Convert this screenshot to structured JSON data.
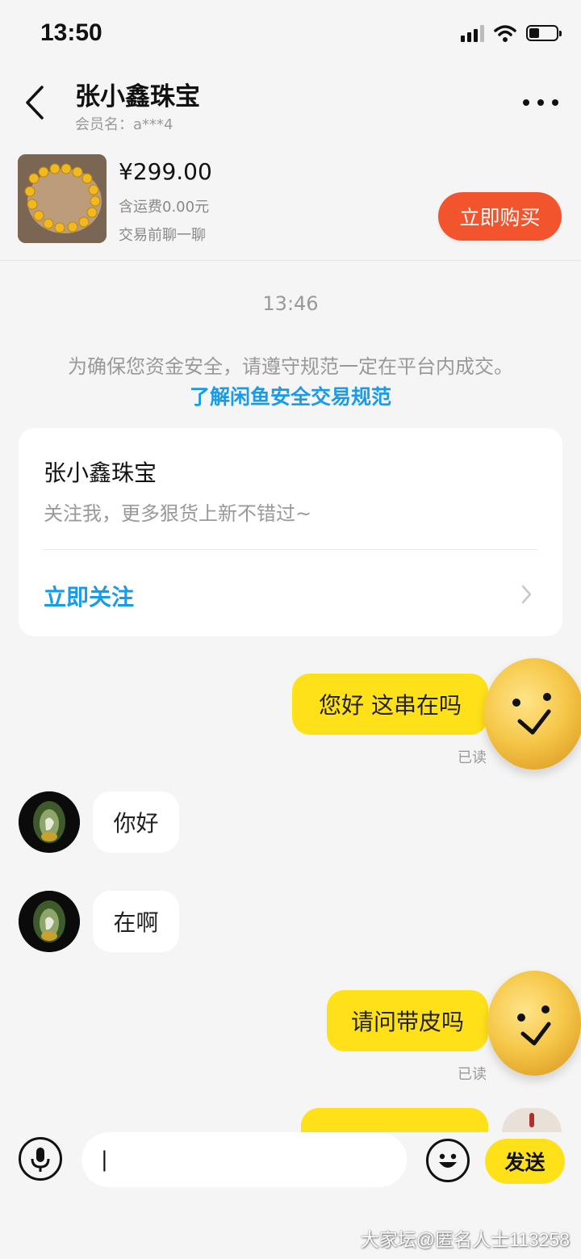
{
  "status_bar": {
    "time": "13:50"
  },
  "header": {
    "shop_name": "张小鑫珠宝",
    "member_name": "会员名：a***4"
  },
  "product": {
    "price": "¥299.00",
    "shipping": "含运费0.00元",
    "chat_before": "交易前聊一聊",
    "buy_label": "立即购买"
  },
  "chat": {
    "time": "13:46",
    "safety_note": "为确保您资金安全，请遵守规范一定在平台内成交。",
    "safety_link": "了解闲鱼安全交易规范",
    "follow_card": {
      "title": "张小鑫珠宝",
      "subtitle": "关注我，更多狠货上新不错过~",
      "action": "立即关注"
    },
    "messages": [
      {
        "from": "me",
        "text": "您好 这串在吗",
        "status": "已读"
      },
      {
        "from": "other",
        "text": "你好"
      },
      {
        "from": "other",
        "text": "在啊"
      },
      {
        "from": "me",
        "text": "请问带皮吗",
        "status": "已读"
      }
    ]
  },
  "input_bar": {
    "input_value": "|",
    "send_label": "发送"
  },
  "watermark": "大家坛@匿名人士113258",
  "colors": {
    "accent_yellow": "#ffe11a",
    "buy_orange": "#f2542d",
    "link_blue": "#1a9be8"
  },
  "icons": [
    "back-icon",
    "more-icon",
    "chevron-right-icon",
    "mic-icon",
    "emoji-icon",
    "signal-icon",
    "wifi-icon",
    "battery-icon"
  ]
}
